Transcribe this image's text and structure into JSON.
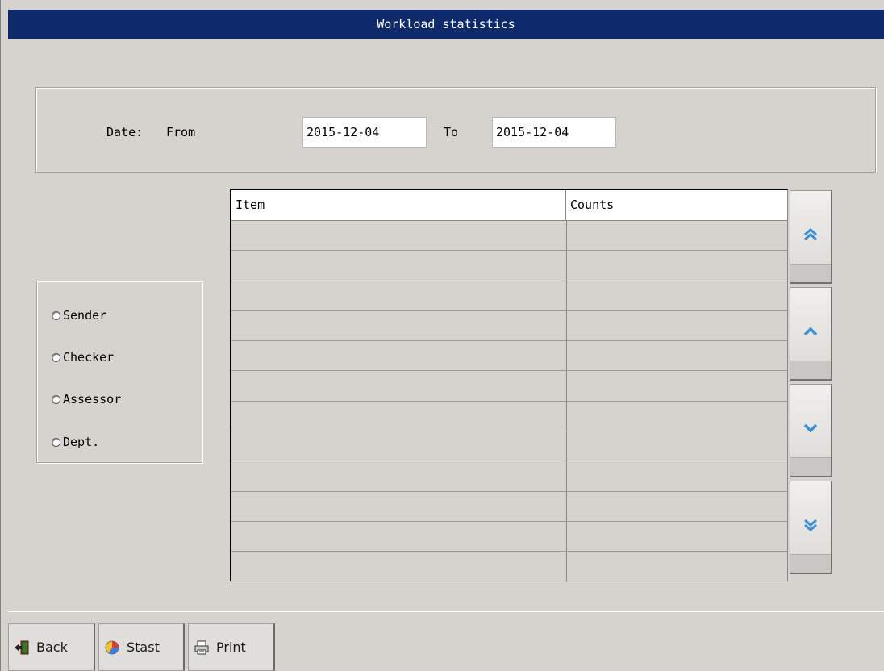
{
  "window": {
    "title": "Workload statistics"
  },
  "date_filter": {
    "label": "Date:",
    "from_label": "From",
    "from_value": "2015-12-04",
    "to_label": "To",
    "to_value": "2015-12-04"
  },
  "group_by": {
    "options": [
      {
        "label": "Sender",
        "selected": false
      },
      {
        "label": "Checker",
        "selected": false
      },
      {
        "label": "Assessor",
        "selected": false
      },
      {
        "label": "Dept.",
        "selected": false
      }
    ]
  },
  "table": {
    "columns": [
      "Item",
      "Counts"
    ],
    "rows": [
      [
        "",
        ""
      ],
      [
        "",
        ""
      ],
      [
        "",
        ""
      ],
      [
        "",
        ""
      ],
      [
        "",
        ""
      ],
      [
        "",
        ""
      ],
      [
        "",
        ""
      ],
      [
        "",
        ""
      ],
      [
        "",
        ""
      ],
      [
        "",
        ""
      ],
      [
        "",
        ""
      ],
      [
        "",
        ""
      ]
    ]
  },
  "scroll_buttons": [
    "scroll-to-top-icon",
    "scroll-up-icon",
    "scroll-down-icon",
    "scroll-to-bottom-icon"
  ],
  "toolbar": {
    "back_label": "Back",
    "stast_label": "Stast",
    "print_label": "Print"
  },
  "colors": {
    "title_bar": "#0f2a6b",
    "background": "#d6d3ce",
    "scroll_arrow": "#3a8fd6"
  }
}
